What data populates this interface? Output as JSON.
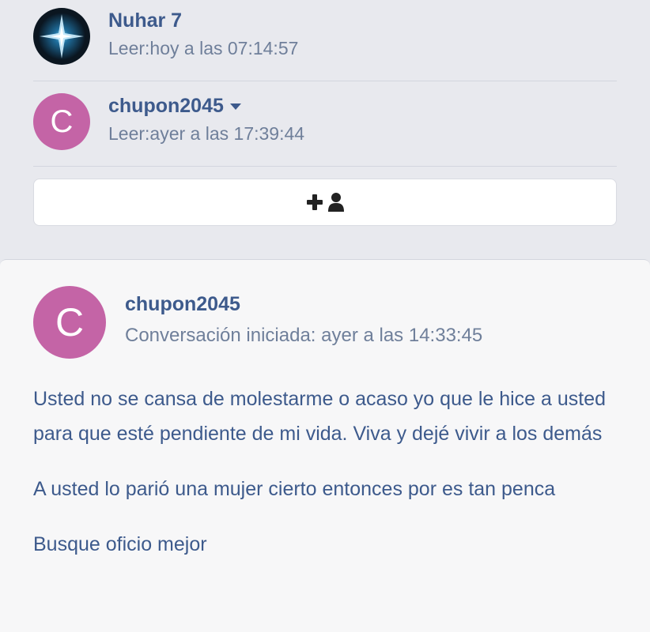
{
  "participants": [
    {
      "name": "Nuhar 7",
      "read": "Leer:hoy a las 07:14:57",
      "avatar_icon": "star-avatar"
    },
    {
      "name": "chupon2045",
      "read": "Leer:ayer a las 17:39:44",
      "avatar_letter": "C"
    }
  ],
  "add_participant_icons": [
    "plus-icon",
    "user-icon"
  ],
  "message": {
    "avatar_letter": "C",
    "author": "chupon2045",
    "started": "Conversación iniciada: ayer a las 14:33:45",
    "paragraphs": [
      "Usted no se cansa de molestarme o acaso yo que le hice a usted para que esté pendiente de mi vida. Viva y dejé vivir a los demás",
      "A usted lo parió una mujer cierto entonces por es tan penca",
      "Busque oficio mejor"
    ]
  },
  "colors": {
    "accent": "#3d5a8c",
    "avatar": "#c464a6",
    "muted": "#6f7f9a"
  }
}
